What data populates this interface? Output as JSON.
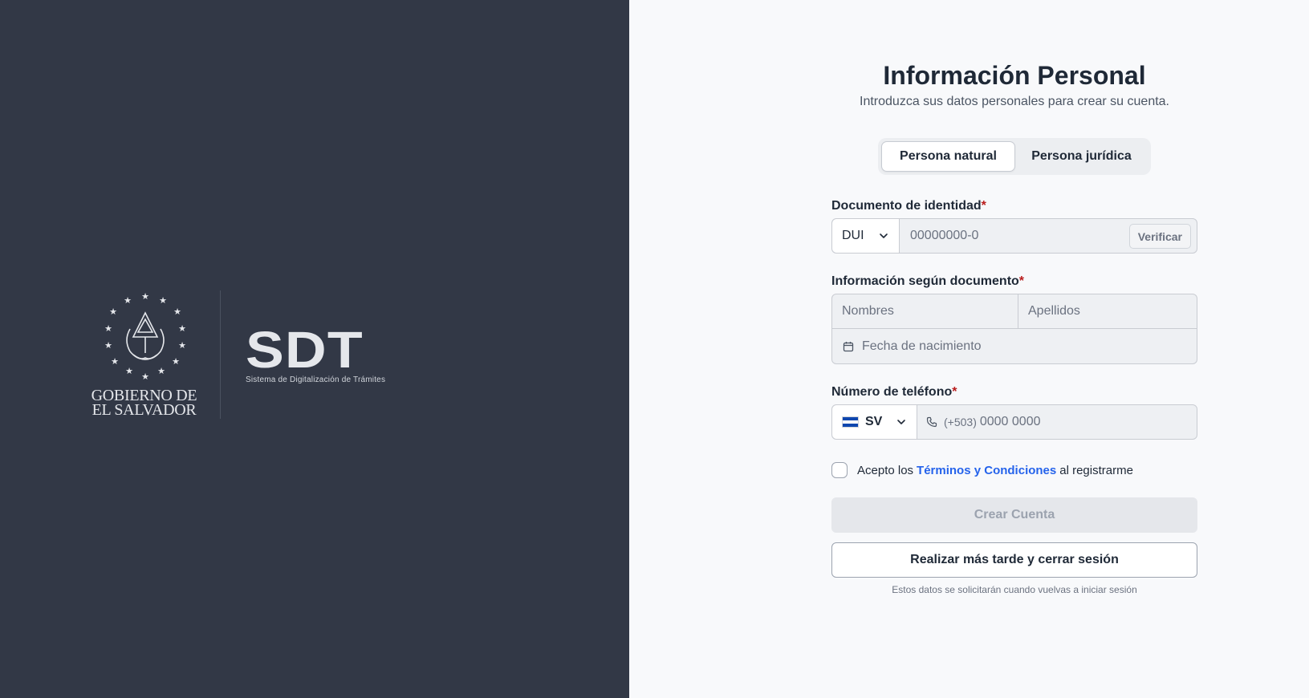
{
  "branding": {
    "gov_line1": "GOBIERNO DE",
    "gov_line2": "EL SALVADOR",
    "sdt_mark": "SDT",
    "sdt_subtitle": "Sistema de Digitalización de Trámites"
  },
  "header": {
    "title": "Información Personal",
    "subtitle": "Introduzca sus datos personales para crear su cuenta."
  },
  "person_type": {
    "options": [
      "Persona natural",
      "Persona jurídica"
    ],
    "selected": "Persona natural"
  },
  "document": {
    "label": "Documento de identidad",
    "required_mark": "*",
    "type_value": "DUI",
    "number_placeholder": "00000000-0",
    "verify_label": "Verificar"
  },
  "info": {
    "label": "Información según documento",
    "required_mark": "*",
    "first_name_placeholder": "Nombres",
    "last_name_placeholder": "Apellidos",
    "birthdate_placeholder": "Fecha de nacimiento"
  },
  "phone": {
    "label": "Número de teléfono",
    "required_mark": "*",
    "country_code": "SV",
    "prefix": "(+503)",
    "placeholder": "0000 0000"
  },
  "terms": {
    "prefix": "Acepto los",
    "link": "Términos y Condiciones",
    "suffix": "al registrarme",
    "checked": false
  },
  "actions": {
    "create_label": "Crear Cuenta",
    "later_label": "Realizar más tarde y cerrar sesión",
    "footnote": "Estos datos se solicitarán cuando vuelvas a iniciar sesión"
  },
  "colors": {
    "left_panel": "#323846",
    "link": "#2563eb",
    "required": "#b91c1c",
    "flag_blue": "#0f47af"
  }
}
